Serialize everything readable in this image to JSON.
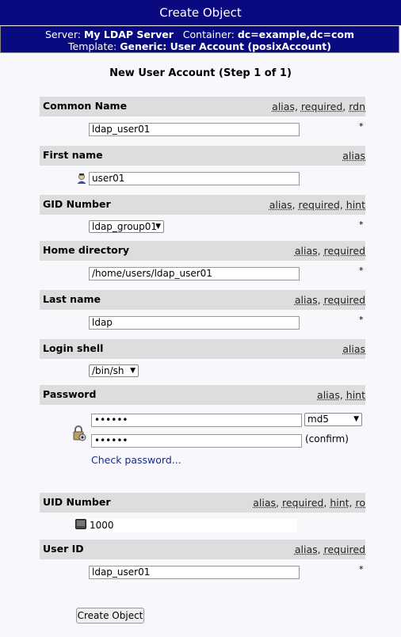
{
  "title": "Create Object",
  "server_label": "Server:",
  "server": "My LDAP Server",
  "container_label": "Container:",
  "container": "dc=example,dc=com",
  "template_label": "Template:",
  "template": "Generic: User Account (posixAccount)",
  "heading": "New User Account (Step 1 of 1)",
  "required_mark": "*",
  "attrs": {
    "cn": {
      "name": "Common Name",
      "flags": [
        "alias",
        "required",
        "rdn"
      ],
      "value": "ldap_user01"
    },
    "givenname": {
      "name": "First name",
      "flags": [
        "alias"
      ],
      "value": "user01"
    },
    "gid": {
      "name": "GID Number",
      "flags": [
        "alias",
        "required",
        "hint"
      ],
      "value": "ldap_group01"
    },
    "home": {
      "name": "Home directory",
      "flags": [
        "alias",
        "required"
      ],
      "value": "/home/users/ldap_user01"
    },
    "sn": {
      "name": "Last name",
      "flags": [
        "alias",
        "required"
      ],
      "value": "ldap"
    },
    "shell": {
      "name": "Login shell",
      "flags": [
        "alias"
      ],
      "value": "/bin/sh"
    },
    "password": {
      "name": "Password",
      "flags": [
        "alias",
        "hint"
      ],
      "value": "••••••",
      "confirm_value": "••••••",
      "hash": "md5",
      "confirm_label": "(confirm)",
      "check_link": "Check password..."
    },
    "uid_number": {
      "name": "UID Number",
      "flags": [
        "alias",
        "required",
        "hint",
        "ro"
      ],
      "value": "1000"
    },
    "uid": {
      "name": "User ID",
      "flags": [
        "alias",
        "required"
      ],
      "value": "ldap_user01"
    }
  },
  "submit_label": "Create Object",
  "icons": {
    "user": "user-icon",
    "lock": "lock-icon",
    "uid": "terminal-icon"
  }
}
